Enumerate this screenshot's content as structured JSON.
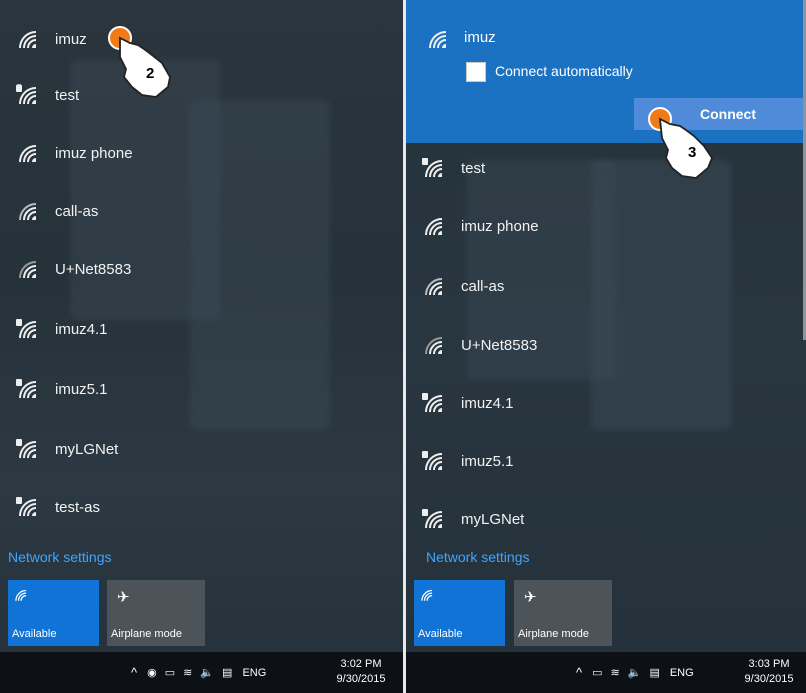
{
  "left": {
    "networks": [
      {
        "name": "imuz",
        "secured": false
      },
      {
        "name": "test",
        "secured": true
      },
      {
        "name": "imuz phone",
        "secured": false
      },
      {
        "name": "call-as",
        "secured": false
      },
      {
        "name": "U+Net8583",
        "secured": false
      },
      {
        "name": "imuz4.1",
        "secured": true
      },
      {
        "name": "imuz5.1",
        "secured": true
      },
      {
        "name": "myLGNet",
        "secured": true
      },
      {
        "name": "test-as",
        "secured": true
      }
    ],
    "network_settings": "Network settings",
    "tile_available": "Available",
    "tile_airplane": "Airplane mode",
    "lang": "ENG",
    "time": "3:02 PM",
    "date": "9/30/2015",
    "step": "2"
  },
  "right": {
    "selected": "imuz",
    "connect_auto": "Connect automatically",
    "connect": "Connect",
    "networks": [
      {
        "name": "test",
        "secured": true
      },
      {
        "name": "imuz phone",
        "secured": false
      },
      {
        "name": "call-as",
        "secured": false
      },
      {
        "name": "U+Net8583",
        "secured": false
      },
      {
        "name": "imuz4.1",
        "secured": true
      },
      {
        "name": "imuz5.1",
        "secured": true
      },
      {
        "name": "myLGNet",
        "secured": true
      }
    ],
    "network_settings": "Network settings",
    "tile_available": "Available",
    "tile_airplane": "Airplane mode",
    "lang": "ENG",
    "time": "3:03 PM",
    "date": "9/30/2015",
    "step": "3"
  },
  "colors": {
    "accent": "#1173d6",
    "link": "#3ea6ff",
    "selected_bg": "#1b72c2",
    "pointer_dot": "#f07b16"
  }
}
